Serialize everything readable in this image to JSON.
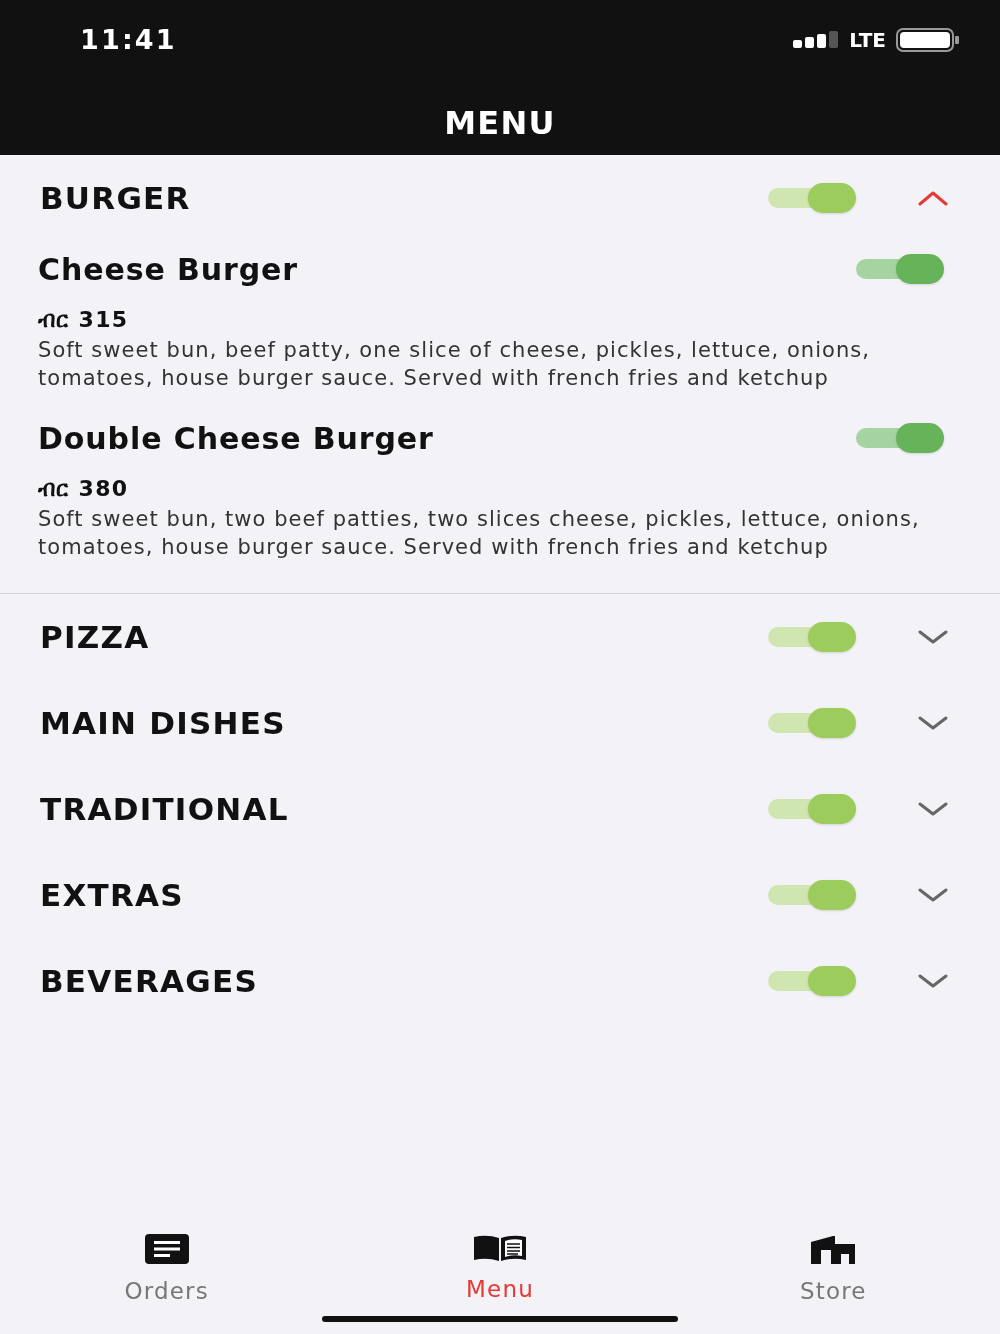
{
  "status_bar": {
    "time": "11:41",
    "network": "LTE"
  },
  "header": {
    "title": "MENU"
  },
  "categories": [
    {
      "name": "BURGER",
      "on": true,
      "expanded": true,
      "items": [
        {
          "name": "Cheese Burger",
          "on": true,
          "price": "ብር 315",
          "description": "Soft sweet bun, beef patty, one slice of cheese, pickles, lettuce, onions, tomatoes, house burger sauce. Served with french fries and ketchup"
        },
        {
          "name": "Double Cheese Burger",
          "on": true,
          "price": "ብር 380",
          "description": "Soft sweet bun, two beef patties, two slices cheese, pickles, lettuce, onions, tomatoes, house burger sauce. Served with french fries and ketchup"
        }
      ]
    },
    {
      "name": "PIZZA",
      "on": true,
      "expanded": false
    },
    {
      "name": "MAIN DISHES",
      "on": true,
      "expanded": false
    },
    {
      "name": "TRADITIONAL",
      "on": true,
      "expanded": false
    },
    {
      "name": "EXTRAS",
      "on": true,
      "expanded": false
    },
    {
      "name": "BEVERAGES",
      "on": true,
      "expanded": false
    }
  ],
  "tab_bar": [
    {
      "label": "Orders",
      "kind": "orders",
      "selected": false
    },
    {
      "label": "Menu",
      "kind": "menu",
      "selected": true
    },
    {
      "label": "Store",
      "kind": "store",
      "selected": false
    }
  ]
}
